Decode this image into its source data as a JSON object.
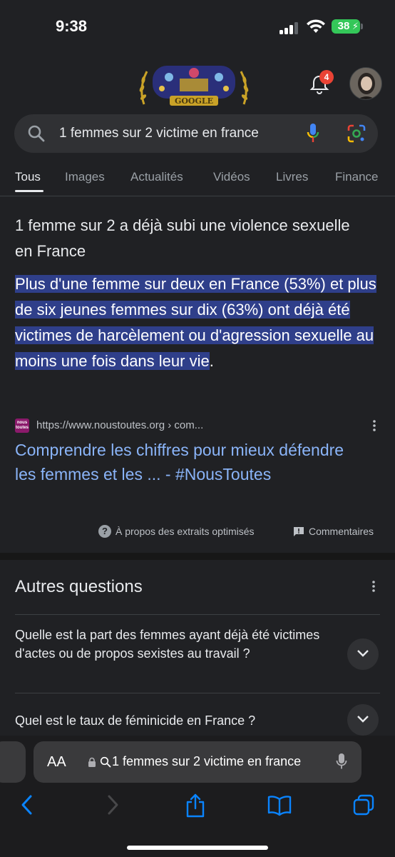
{
  "status_bar": {
    "time": "9:38",
    "battery_level": "38",
    "battery_color": "#34c759"
  },
  "header": {
    "doodle_text": "GOOGLE",
    "notification_count": "4"
  },
  "search": {
    "query": "1 femmes sur 2 victime en france"
  },
  "tabs": [
    {
      "label": "Tous",
      "active": true
    },
    {
      "label": "Images"
    },
    {
      "label": "Actualités"
    },
    {
      "label": "Vidéos"
    },
    {
      "label": "Livres"
    },
    {
      "label": "Finance"
    }
  ],
  "snippet": {
    "title": "1 femme sur 2 a déjà subi une violence sexuelle en France",
    "body_highlighted": "Plus d'une femme sur deux en France (53%) et plus de six jeunes femmes sur dix (63%) ont déjà été victimes de harcèlement ou d'agression sexuelle au moins une fois dans leur vie",
    "body_end": ".",
    "favicon_text": "nous toutes",
    "source_url": "https://www.noustoutes.org › com...",
    "link_title": "Comprendre les chiffres pour mieux défendre les femmes et les ... - #NousToutes",
    "about_label": "À propos des extraits optimisés",
    "feedback_label": "Commentaires",
    "highlight_color": "#2f3f8a",
    "link_color": "#8ab4f8"
  },
  "paa": {
    "title": "Autres questions",
    "questions": [
      "Quelle est la part des femmes ayant déjà été victimes d'actes ou de propos sexistes au travail ?",
      "Quel est le taux de féminicide en France ?"
    ]
  },
  "safari": {
    "aa_label": "AA",
    "url_text": "1 femmes sur 2 victime en france"
  },
  "icons": [
    "search-icon",
    "mic-icon",
    "lens-icon",
    "bell-icon",
    "more-vert-icon",
    "help-icon",
    "feedback-icon",
    "chevron-down-icon",
    "lock-icon",
    "back-icon",
    "forward-icon",
    "share-icon",
    "bookmarks-icon",
    "tabs-icon"
  ]
}
